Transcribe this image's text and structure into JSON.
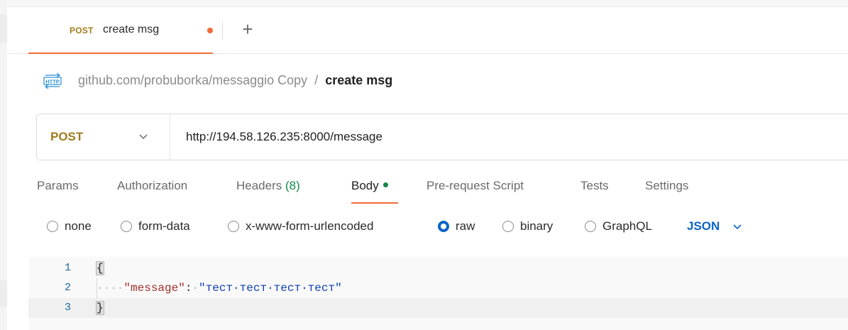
{
  "tab": {
    "method": "POST",
    "name": "create msg",
    "unsaved": true,
    "new_tab_glyph": "+"
  },
  "breadcrumb": {
    "icon": "http-request-icon",
    "collection": "github.com/probuborka/messaggio Copy",
    "separator": "/",
    "current": "create msg"
  },
  "request": {
    "method": "POST",
    "url": "http://194.58.126.235:8000/message"
  },
  "request_tabs": {
    "params": "Params",
    "authorization": "Authorization",
    "headers": "Headers",
    "headers_count": "(8)",
    "body": "Body",
    "pre_request": "Pre-request Script",
    "tests": "Tests",
    "settings": "Settings",
    "active": "body"
  },
  "body_modes": {
    "none": "none",
    "form_data": "form-data",
    "urlencoded": "x-www-form-urlencoded",
    "raw": "raw",
    "binary": "binary",
    "graphql": "GraphQL",
    "selected": "raw",
    "language": "JSON"
  },
  "editor": {
    "lines": [
      {
        "num": "1",
        "open": "{"
      },
      {
        "num": "2",
        "indent": "····",
        "key": "\"message\"",
        "colon": ":",
        "space": "·",
        "value": "\"тест·тест·тест·тест\""
      },
      {
        "num": "3",
        "close": "}"
      }
    ]
  },
  "colors": {
    "accent_orange": "#f26b3a",
    "method_post": "#a07c1e",
    "active_green": "#0f8a4a",
    "radio_blue": "#0b64c8",
    "json_key": "#a3312a",
    "json_string": "#0d3fb0"
  }
}
